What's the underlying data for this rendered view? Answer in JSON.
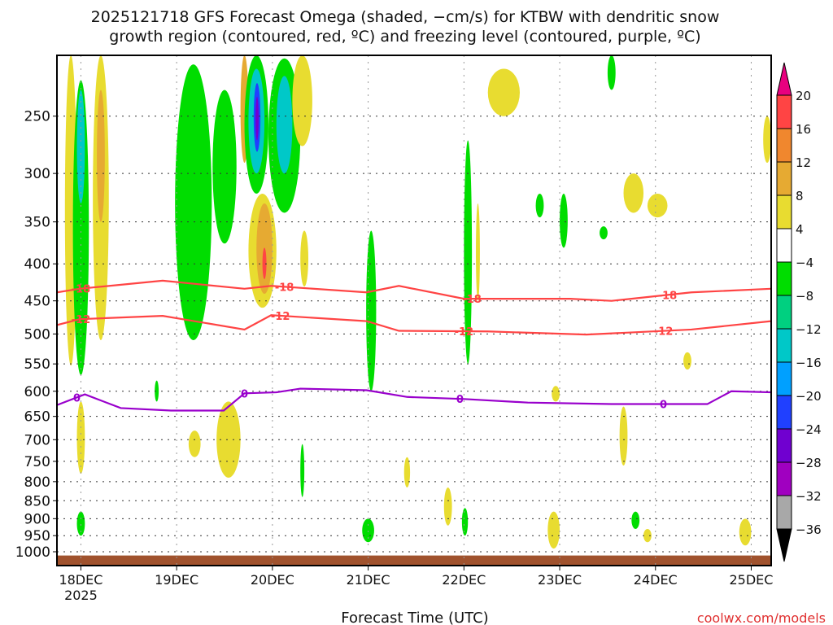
{
  "chart_data": {
    "type": "heatmap",
    "title_line1": "2025121718 GFS Forecast Omega (shaded, −cm/s) for KTBW with dendritic snow",
    "title_line2": "growth region (contoured, red, ºC) and freezing level (contoured, purple, ºC)",
    "xlabel": "Forecast Time (UTC)",
    "credit": "coolwx.com/models",
    "x_units": "hours since 2025-12-17 18Z",
    "xlim": [
      0,
      179
    ],
    "ylim": [
      1045,
      206
    ],
    "y_scale": "log",
    "grid": true,
    "x_ticks": [
      {
        "hour": 6,
        "label": "18DEC",
        "sub": "2025"
      },
      {
        "hour": 30,
        "label": "19DEC"
      },
      {
        "hour": 54,
        "label": "20DEC"
      },
      {
        "hour": 78,
        "label": "21DEC"
      },
      {
        "hour": 102,
        "label": "22DEC"
      },
      {
        "hour": 126,
        "label": "23DEC"
      },
      {
        "hour": 150,
        "label": "24DEC"
      },
      {
        "hour": 174,
        "label": "25DEC"
      }
    ],
    "y_ticks": [
      "250",
      "300",
      "350",
      "400",
      "450",
      "500",
      "550",
      "600",
      "650",
      "700",
      "750",
      "800",
      "850",
      "900",
      "950",
      "1000"
    ],
    "colorbar": {
      "labels": [
        "20",
        "16",
        "12",
        "8",
        "4",
        "−4",
        "−8",
        "−12",
        "−16",
        "−20",
        "−24",
        "−28",
        "−32",
        "−36"
      ],
      "bands": [
        {
          "min": 16,
          "max": 20,
          "color": "#ff4444"
        },
        {
          "min": 12,
          "max": 16,
          "color": "#f0872e"
        },
        {
          "min": 8,
          "max": 12,
          "color": "#e6aa32"
        },
        {
          "min": 4,
          "max": 8,
          "color": "#e8dc30"
        },
        {
          "min": -4,
          "max": 4,
          "color": "#ffffff"
        },
        {
          "min": -8,
          "max": -4,
          "color": "#00dd00"
        },
        {
          "min": -12,
          "max": -8,
          "color": "#00d080"
        },
        {
          "min": -16,
          "max": -12,
          "color": "#00c8c8"
        },
        {
          "min": -20,
          "max": -16,
          "color": "#00a0ff"
        },
        {
          "min": -24,
          "max": -20,
          "color": "#2040ff"
        },
        {
          "min": -28,
          "max": -24,
          "color": "#7000d0"
        },
        {
          "min": -32,
          "max": -28,
          "color": "#a000c0"
        },
        {
          "min": -36,
          "max": -32,
          "color": "#a8a8a8"
        }
      ],
      "over_color": "#e8007f",
      "under_color": "#000000"
    },
    "ground_color": "#a0522d",
    "omega_regions": [
      {
        "t": [
          2,
          5
        ],
        "p": [
          206,
          553
        ],
        "v": 6
      },
      {
        "t": [
          4,
          8
        ],
        "p": [
          223,
          570
        ],
        "v": -6
      },
      {
        "t": [
          5,
          7
        ],
        "p": [
          230,
          330
        ],
        "v": -14
      },
      {
        "t": [
          9,
          13
        ],
        "p": [
          206,
          510
        ],
        "v": 6
      },
      {
        "t": [
          10,
          12
        ],
        "p": [
          230,
          350
        ],
        "v": 10
      },
      {
        "t": [
          29.6,
          38.8
        ],
        "p": [
          212,
          510
        ],
        "v": -6
      },
      {
        "t": [
          39,
          45
        ],
        "p": [
          230,
          375
        ],
        "v": -6
      },
      {
        "t": [
          46,
          48
        ],
        "p": [
          206,
          290
        ],
        "v": 10
      },
      {
        "t": [
          47,
          53
        ],
        "p": [
          206,
          320
        ],
        "v": -6
      },
      {
        "t": [
          48,
          52
        ],
        "p": [
          215,
          300
        ],
        "v": -14
      },
      {
        "t": [
          49.3,
          51
        ],
        "p": [
          225,
          280
        ],
        "v": -22
      },
      {
        "t": [
          49.8,
          50.5
        ],
        "p": [
          235,
          270
        ],
        "v": -26
      },
      {
        "t": [
          53,
          61
        ],
        "p": [
          208,
          340
        ],
        "v": -6
      },
      {
        "t": [
          55,
          59
        ],
        "p": [
          220,
          300
        ],
        "v": -14
      },
      {
        "t": [
          48,
          55
        ],
        "p": [
          320,
          460
        ],
        "v": 6
      },
      {
        "t": [
          50,
          54
        ],
        "p": [
          330,
          440
        ],
        "v": 10
      },
      {
        "t": [
          51.5,
          52.5
        ],
        "p": [
          380,
          420
        ],
        "v": 18
      },
      {
        "t": [
          59,
          64
        ],
        "p": [
          206,
          275
        ],
        "v": 6
      },
      {
        "t": [
          61,
          63
        ],
        "p": [
          360,
          430
        ],
        "v": 6
      },
      {
        "t": [
          77.5,
          80
        ],
        "p": [
          360,
          600
        ],
        "v": -6
      },
      {
        "t": [
          102,
          104
        ],
        "p": [
          270,
          550
        ],
        "v": -6
      },
      {
        "t": [
          105,
          106
        ],
        "p": [
          330,
          450
        ],
        "v": 6
      },
      {
        "t": [
          108,
          116
        ],
        "p": [
          215,
          250
        ],
        "v": 6
      },
      {
        "t": [
          120,
          122
        ],
        "p": [
          320,
          345
        ],
        "v": -6
      },
      {
        "t": [
          126,
          128
        ],
        "p": [
          320,
          380
        ],
        "v": -6
      },
      {
        "t": [
          136,
          138
        ],
        "p": [
          355,
          370
        ],
        "v": -6
      },
      {
        "t": [
          138,
          140
        ],
        "p": [
          206,
          230
        ],
        "v": -6
      },
      {
        "t": [
          142,
          147
        ],
        "p": [
          300,
          340
        ],
        "v": 6
      },
      {
        "t": [
          148,
          153
        ],
        "p": [
          320,
          345
        ],
        "v": 6
      },
      {
        "t": [
          177,
          179
        ],
        "p": [
          250,
          290
        ],
        "v": 6
      },
      {
        "t": [
          141,
          143
        ],
        "p": [
          630,
          760
        ],
        "v": 6
      },
      {
        "t": [
          124,
          126
        ],
        "p": [
          590,
          620
        ],
        "v": 6
      },
      {
        "t": [
          123,
          126
        ],
        "p": [
          880,
          990
        ],
        "v": 6
      },
      {
        "t": [
          171,
          174
        ],
        "p": [
          900,
          980
        ],
        "v": 6
      },
      {
        "t": [
          157,
          159
        ],
        "p": [
          530,
          560
        ],
        "v": 6
      },
      {
        "t": [
          5,
          7
        ],
        "p": [
          880,
          950
        ],
        "v": -6
      },
      {
        "t": [
          76.5,
          79.5
        ],
        "p": [
          900,
          970
        ],
        "v": -6
      },
      {
        "t": [
          101.5,
          103
        ],
        "p": [
          870,
          950
        ],
        "v": -6
      },
      {
        "t": [
          40,
          46
        ],
        "p": [
          620,
          790
        ],
        "v": 6
      },
      {
        "t": [
          33,
          36
        ],
        "p": [
          680,
          740
        ],
        "v": 6
      },
      {
        "t": [
          5,
          7
        ],
        "p": [
          620,
          780
        ],
        "v": 6
      },
      {
        "t": [
          144,
          146
        ],
        "p": [
          880,
          930
        ],
        "v": -6
      },
      {
        "t": [
          147,
          149
        ],
        "p": [
          930,
          970
        ],
        "v": 6
      },
      {
        "t": [
          61,
          62
        ],
        "p": [
          710,
          840
        ],
        "v": -6
      },
      {
        "t": [
          24.5,
          25.5
        ],
        "p": [
          580,
          620
        ],
        "v": -6
      },
      {
        "t": [
          97,
          99
        ],
        "p": [
          815,
          920
        ],
        "v": 6
      },
      {
        "t": [
          87,
          88.5
        ],
        "p": [
          740,
          815
        ],
        "v": 6
      }
    ],
    "contours": [
      {
        "name": "minus-18-isotherm",
        "label": "-18",
        "color": "#ff4444",
        "label_hours": [
          6,
          57,
          104,
          153
        ],
        "points": [
          [
            0,
            438
          ],
          [
            5.7,
            433
          ],
          [
            26.5,
            422
          ],
          [
            47,
            433
          ],
          [
            53.7,
            429
          ],
          [
            77.6,
            438
          ],
          [
            85.7,
            429
          ],
          [
            102,
            447
          ],
          [
            128.6,
            447
          ],
          [
            139,
            450
          ],
          [
            159,
            438
          ],
          [
            179,
            433
          ]
        ]
      },
      {
        "name": "minus-12-isotherm",
        "label": "-12",
        "color": "#ff4444",
        "label_hours": [
          6,
          56,
          102,
          152
        ],
        "points": [
          [
            0,
            486
          ],
          [
            5.7,
            477
          ],
          [
            26.5,
            472
          ],
          [
            47,
            493
          ],
          [
            53.7,
            471
          ],
          [
            77.6,
            480
          ],
          [
            85.7,
            495
          ],
          [
            108,
            496
          ],
          [
            132.7,
            501
          ],
          [
            159,
            493
          ],
          [
            179,
            480
          ]
        ]
      },
      {
        "name": "freezing-level",
        "label": "0",
        "color": "#9900cc",
        "label_hours": [
          5,
          47,
          101,
          152
        ],
        "points": [
          [
            0,
            627
          ],
          [
            7,
            606
          ],
          [
            16,
            633
          ],
          [
            28.6,
            638
          ],
          [
            41.8,
            638
          ],
          [
            47,
            604
          ],
          [
            55,
            602
          ],
          [
            61,
            595
          ],
          [
            77.6,
            598
          ],
          [
            87.8,
            611
          ],
          [
            102,
            615
          ],
          [
            118,
            622
          ],
          [
            139,
            625
          ],
          [
            163,
            625
          ],
          [
            169,
            600
          ],
          [
            179,
            602
          ]
        ]
      }
    ]
  }
}
